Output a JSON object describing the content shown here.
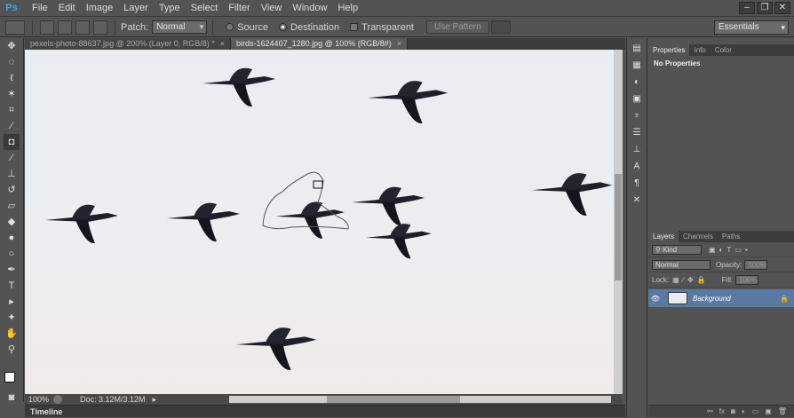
{
  "app": {
    "logo": "Ps"
  },
  "menu": [
    "File",
    "Edit",
    "Image",
    "Layer",
    "Type",
    "Select",
    "Filter",
    "View",
    "Window",
    "Help"
  ],
  "options": {
    "patch_label": "Patch:",
    "patch_mode": "Normal",
    "source_label": "Source",
    "destination_label": "Destination",
    "transparent_label": "Transparent",
    "use_pattern_label": "Use Pattern",
    "workspace": "Essentials"
  },
  "tabs": [
    {
      "label": "pexels-photo-88637.jpg @ 200% (Layer 0, RGB/8) *",
      "close": "×"
    },
    {
      "label": "birds-1624407_1280.jpg @ 100% (RGB/8#)",
      "close": "×"
    }
  ],
  "status": {
    "zoom": "100%",
    "doc": "Doc: 3.12M/3.12M"
  },
  "timeline_label": "Timeline",
  "properties": {
    "tabs": [
      "Properties",
      "Info",
      "Color"
    ],
    "body": "No Properties"
  },
  "layers": {
    "tabs": [
      "Layers",
      "Channels",
      "Paths"
    ],
    "kind_label": "Kind",
    "blend_mode": "Normal",
    "opacity_label": "Opacity:",
    "opacity_value": "100%",
    "lock_label": "Lock:",
    "fill_label": "Fill:",
    "fill_value": "100%",
    "items": [
      {
        "name": "Background"
      }
    ]
  },
  "colors": {
    "canvas_top": "#e9edf2",
    "selection": "#5b7aa3",
    "accent": "#31a8ff"
  }
}
